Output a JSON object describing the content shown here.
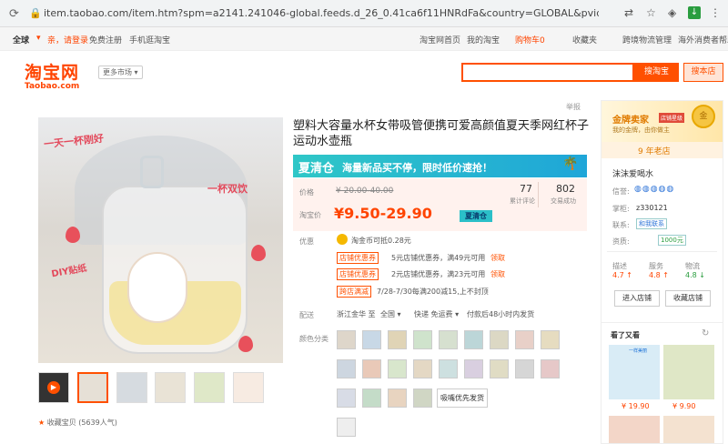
{
  "browser": {
    "url": "item.taobao.com/item.htm?spm=a2141.241046-global.feeds.d_26_0.41ca6f11HNRdFa&country=GLOBAL&pvid=32bf947e-cecd-4b69-889d-d97a279..."
  },
  "topnav": {
    "region": "全球",
    "greeting": "亲，请登录",
    "register": "免费注册",
    "mobile": "手机逛淘宝",
    "home": "淘宝网首页",
    "my": "我的淘宝",
    "cart": "购物车0",
    "fav": "收藏夹",
    "logistics": "跨境物流管理",
    "overseas": "海外消费者帮助"
  },
  "header": {
    "logo_cn": "淘宝网",
    "logo_en": "Taobao.com",
    "market": "更多市场",
    "search_btn": "搜淘宝",
    "shop_btn": "搜本店"
  },
  "product": {
    "report": "举报",
    "title": "塑料大容量水杯女带吸管便携可爱高颜值夏天季网红杯子运动水壶瓶",
    "overlay": {
      "a": "一天一杯刚好",
      "b": "一杯双饮",
      "c": "DIY贴纸"
    }
  },
  "promo": {
    "title": "夏清仓",
    "text": "海量新品买不停，限时低价速抢！"
  },
  "price": {
    "label": "价格",
    "original": "¥ 20.00-40.00",
    "tb_label": "淘宝价",
    "current": "¥9.50-29.90",
    "badge": "夏清仓",
    "reviews": "77",
    "reviews_label": "累计评论",
    "sales": "802",
    "sales_label": "交易成功"
  },
  "offers": {
    "label": "优惠",
    "coin": "淘金币可抵0.28元",
    "c1_tag": "店铺优惠券",
    "c1": "5元店铺优惠券，满49元可用",
    "c2_tag": "店铺优惠券",
    "c2": "2元店铺优惠券，满23元可用",
    "get": "领取",
    "c3_tag": "跨店满减",
    "c3": "7/28-7/30每满200减15,上不封顶"
  },
  "shipping": {
    "label": "配送",
    "from": "浙江金华 至",
    "to": "全国",
    "fee": "快递 免运费",
    "time": "付款后48小时内发货"
  },
  "color": {
    "label": "颜色分类",
    "more": "吸嘴优先发货"
  },
  "sidebar": {
    "badge": "金牌卖家",
    "badge_tag": "店铺星级",
    "desc": "我的金牌，由你做主",
    "years": "9 年老店",
    "shop": "沫沫爱喝水",
    "credit": "信誉:",
    "deposit": "掌柜:",
    "deposit_val": "z330121",
    "contact": "联系:",
    "contact_val": "和我联系",
    "qual": "资质:",
    "qual_val": "1000元",
    "desc_l": "描述",
    "desc_v": "4.7 ↑",
    "serv_l": "服务",
    "serv_v": "4.8 ↑",
    "log_l": "物流",
    "log_v": "4.8 ↓",
    "enter": "进入店铺",
    "collect": "收藏店铺",
    "seen": "看了又看",
    "p1": "¥ 19.90",
    "p2": "¥ 9.90",
    "card_text": "一样美丽"
  },
  "footer": {
    "fav": "收藏宝贝 (5639人气)"
  },
  "colors": {
    "accent": "#ff5000",
    "price": "#ff4400",
    "gold": "#f5a623"
  }
}
